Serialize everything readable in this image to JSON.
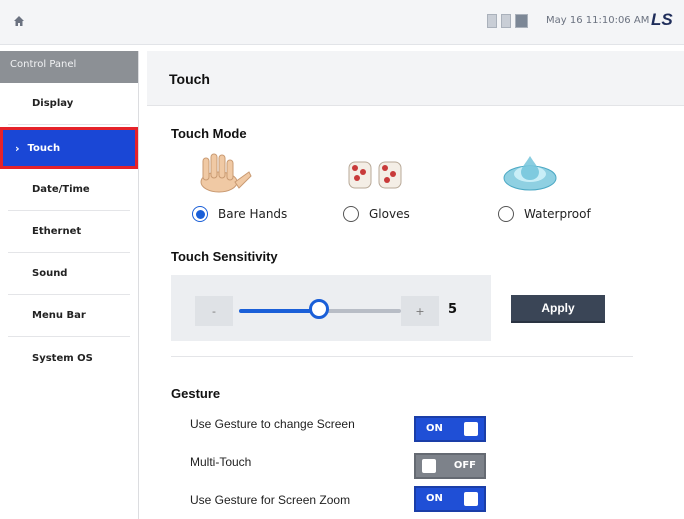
{
  "header": {
    "datetime": "May 16 11:10:06 AM",
    "brand": "LS"
  },
  "sidebar": {
    "title": "Control Panel",
    "items": [
      {
        "label": "Display"
      },
      {
        "label": "Touch",
        "active": true
      },
      {
        "label": "Date/Time"
      },
      {
        "label": "Ethernet"
      },
      {
        "label": "Sound"
      },
      {
        "label": "Menu Bar"
      },
      {
        "label": "System OS"
      }
    ]
  },
  "page": {
    "title": "Touch"
  },
  "touch_mode": {
    "title": "Touch Mode",
    "options": [
      {
        "label": "Bare Hands",
        "selected": true
      },
      {
        "label": "Gloves",
        "selected": false
      },
      {
        "label": "Waterproof",
        "selected": false
      }
    ]
  },
  "sensitivity": {
    "title": "Touch Sensitivity",
    "minus_label": "-",
    "plus_label": "+",
    "value": "5",
    "apply_label": "Apply"
  },
  "gesture": {
    "title": "Gesture",
    "items": [
      {
        "label": "Use Gesture to change Screen",
        "state": "ON"
      },
      {
        "label": "Multi-Touch",
        "state": "OFF"
      },
      {
        "label": "Use Gesture for Screen Zoom",
        "state": "ON"
      }
    ]
  },
  "colors": {
    "accent": "#1a5fd8",
    "active_nav": "#1a47d6",
    "highlight_border": "#e5222a",
    "toggle_off": "#7d828a"
  }
}
